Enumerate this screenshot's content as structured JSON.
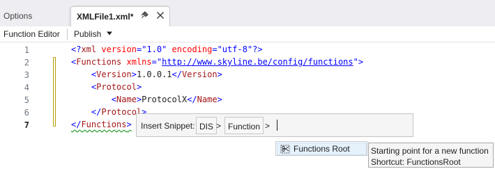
{
  "tabs": {
    "options_label": "Options",
    "active_label": "XMLFile1.xml*",
    "pin_icon": "pin-icon",
    "close_icon": "close-icon"
  },
  "toolbar": {
    "function_editor_label": "Function Editor",
    "publish_label": "Publish",
    "publish_dropdown_icon": "chevron-down-icon"
  },
  "editor": {
    "line_numbers": [
      "1",
      "2",
      "3",
      "4",
      "5",
      "6",
      "7"
    ],
    "current_line": "7",
    "lines": [
      {
        "decl_open": "<?",
        "decl_name": "xml",
        "attr1": "version",
        "eq1": "=",
        "val1": "\"1.0\"",
        "attr2": "encoding",
        "eq2": "=",
        "val2": "\"utf-8\"",
        "decl_close": "?>"
      },
      {
        "open": "<",
        "tag": "Functions",
        "attr": "xmlns",
        "eq": "=",
        "q1": "\"",
        "link": "http://www.skyline.be/config/functions",
        "q2": "\"",
        "close": ">"
      },
      {
        "open": "<",
        "tag": "Version",
        "gt": ">",
        "text": "1.0.0.1",
        "close_open": "</",
        "close_tag": "Version",
        "close_gt": ">"
      },
      {
        "open": "<",
        "tag": "Protocol",
        "gt": ">"
      },
      {
        "open": "<",
        "tag": "Name",
        "gt": ">",
        "text": "ProtocolX",
        "close_open": "</",
        "close_tag": "Name",
        "close_gt": ">"
      },
      {
        "open": "</",
        "tag": "Protocol",
        "gt": ">"
      },
      {
        "open": "</",
        "tag": "Functions",
        "gt": ">"
      }
    ]
  },
  "snippet": {
    "label": "Insert Snippet:",
    "chips": [
      "DIS",
      "Function"
    ],
    "separator": ">"
  },
  "completion": {
    "item_label": "Functions Root",
    "item_icon": "snippet-icon"
  },
  "tooltip": {
    "line1": "Starting point for a new function",
    "line2": "Shortcut: FunctionsRoot"
  },
  "colors": {
    "xml_bracket": "#0000ff",
    "xml_tag": "#a31515",
    "xml_attribute": "#ff0000",
    "xml_value": "#0000ff",
    "change_marker": "#b59c00",
    "squiggle": "#2e9d2e"
  }
}
